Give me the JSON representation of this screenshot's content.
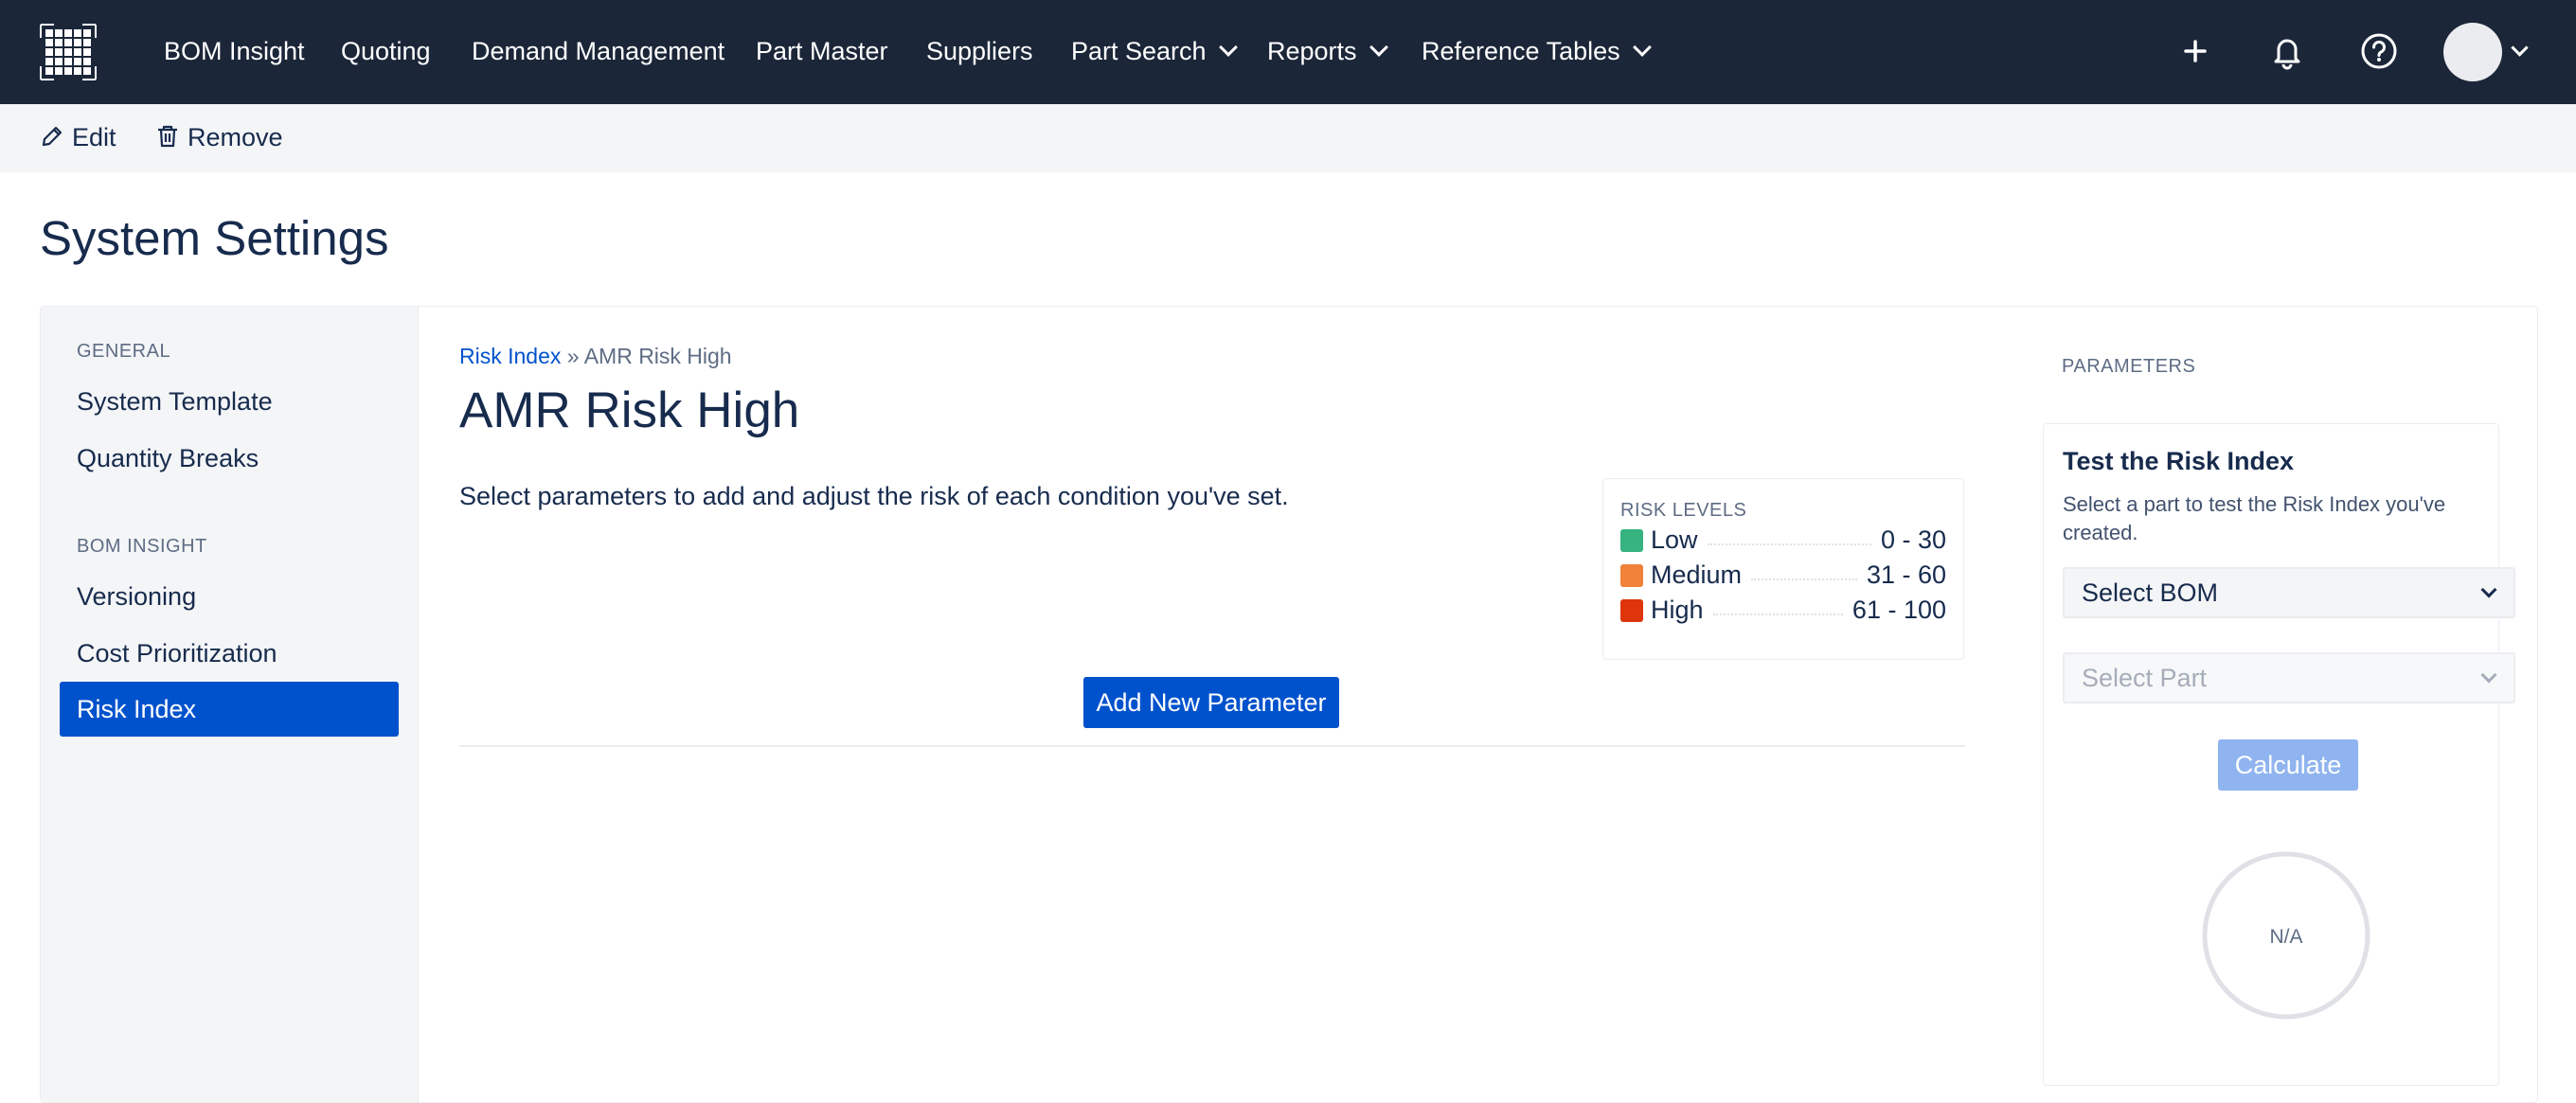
{
  "nav": {
    "items": [
      {
        "label": "BOM Insight",
        "dropdown": false
      },
      {
        "label": "Quoting",
        "dropdown": false
      },
      {
        "label": "Demand Management",
        "dropdown": false
      },
      {
        "label": "Part Master",
        "dropdown": false
      },
      {
        "label": "Suppliers",
        "dropdown": false
      },
      {
        "label": "Part Search",
        "dropdown": true
      },
      {
        "label": "Reports",
        "dropdown": true
      },
      {
        "label": "Reference Tables",
        "dropdown": true
      }
    ],
    "icons": [
      "app-grid-icon",
      "plus-icon",
      "bell-icon",
      "help-icon",
      "avatar",
      "chevron-down-icon"
    ]
  },
  "toolbar": {
    "edit_label": "Edit",
    "remove_label": "Remove",
    "icons": [
      "pencil-icon",
      "trash-icon"
    ]
  },
  "page": {
    "title": "System Settings"
  },
  "sidebar": {
    "sections": [
      {
        "heading": "GENERAL",
        "items": [
          "System Template",
          "Quantity Breaks"
        ]
      },
      {
        "heading": "BOM INSIGHT",
        "items": [
          "Versioning",
          "Cost Prioritization",
          "Risk Index"
        ]
      }
    ],
    "active_item": "Risk Index"
  },
  "main": {
    "breadcrumb": {
      "link": "Risk Index",
      "separator": "»",
      "current": "AMR Risk High"
    },
    "heading": "AMR Risk High",
    "description": "Select parameters to add and adjust the risk of each condition you've set.",
    "add_button": "Add New Parameter"
  },
  "risk_levels": {
    "title": "RISK LEVELS",
    "levels": [
      {
        "name": "Low",
        "range": "0 - 30",
        "color": "#36b37e"
      },
      {
        "name": "Medium",
        "range": "31 - 60",
        "color": "#f0823a"
      },
      {
        "name": "High",
        "range": "61 - 100",
        "color": "#de350b"
      }
    ]
  },
  "parameters": {
    "label": "PARAMETERS",
    "test": {
      "title": "Test the Risk Index",
      "description": "Select a part to test the Risk Index you've created.",
      "bom_select": "Select BOM",
      "part_select": "Select Part",
      "calculate": "Calculate",
      "result": "N/A"
    }
  },
  "colors": {
    "nav_bg": "#1b2638",
    "accent": "#0052cc",
    "accent_disabled": "#8fb4ef"
  }
}
